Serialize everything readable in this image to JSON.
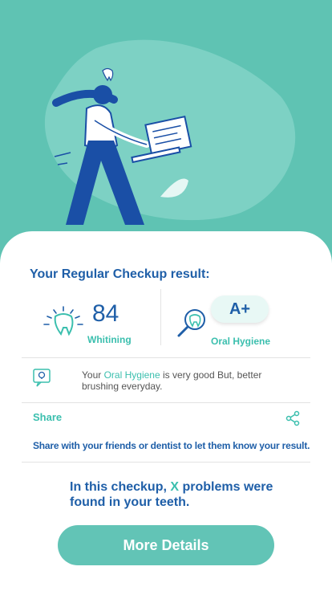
{
  "colors": {
    "background": "#5fc3b3",
    "accent": "#3bbfae",
    "primary_text": "#1f5fa8",
    "button": "#62c4b6"
  },
  "hero": {
    "illustration": "woman-holding-laptop-with-tooth-illustration"
  },
  "result": {
    "title": "Your Regular Checkup result:",
    "whitening": {
      "value": "84",
      "label": "Whitining",
      "icon": "sparkling-tooth-icon"
    },
    "oral_hygiene": {
      "grade": "A+",
      "label": "Oral Hygiene",
      "icon": "magnifier-tooth-icon"
    }
  },
  "tip": {
    "icon": "lightbulb-icon",
    "prefix": "Your ",
    "highlight": "Oral Hygiene",
    "suffix": " is very good But, better brushing everyday."
  },
  "share": {
    "label": "Share",
    "icon": "share-icon",
    "description": "Share with your friends or dentist to let them know your result."
  },
  "summary": {
    "prefix": "In this checkup, ",
    "count": "X",
    "suffix_line1": " problems were",
    "line2": "found in your teeth."
  },
  "button": {
    "label": "More Details"
  }
}
